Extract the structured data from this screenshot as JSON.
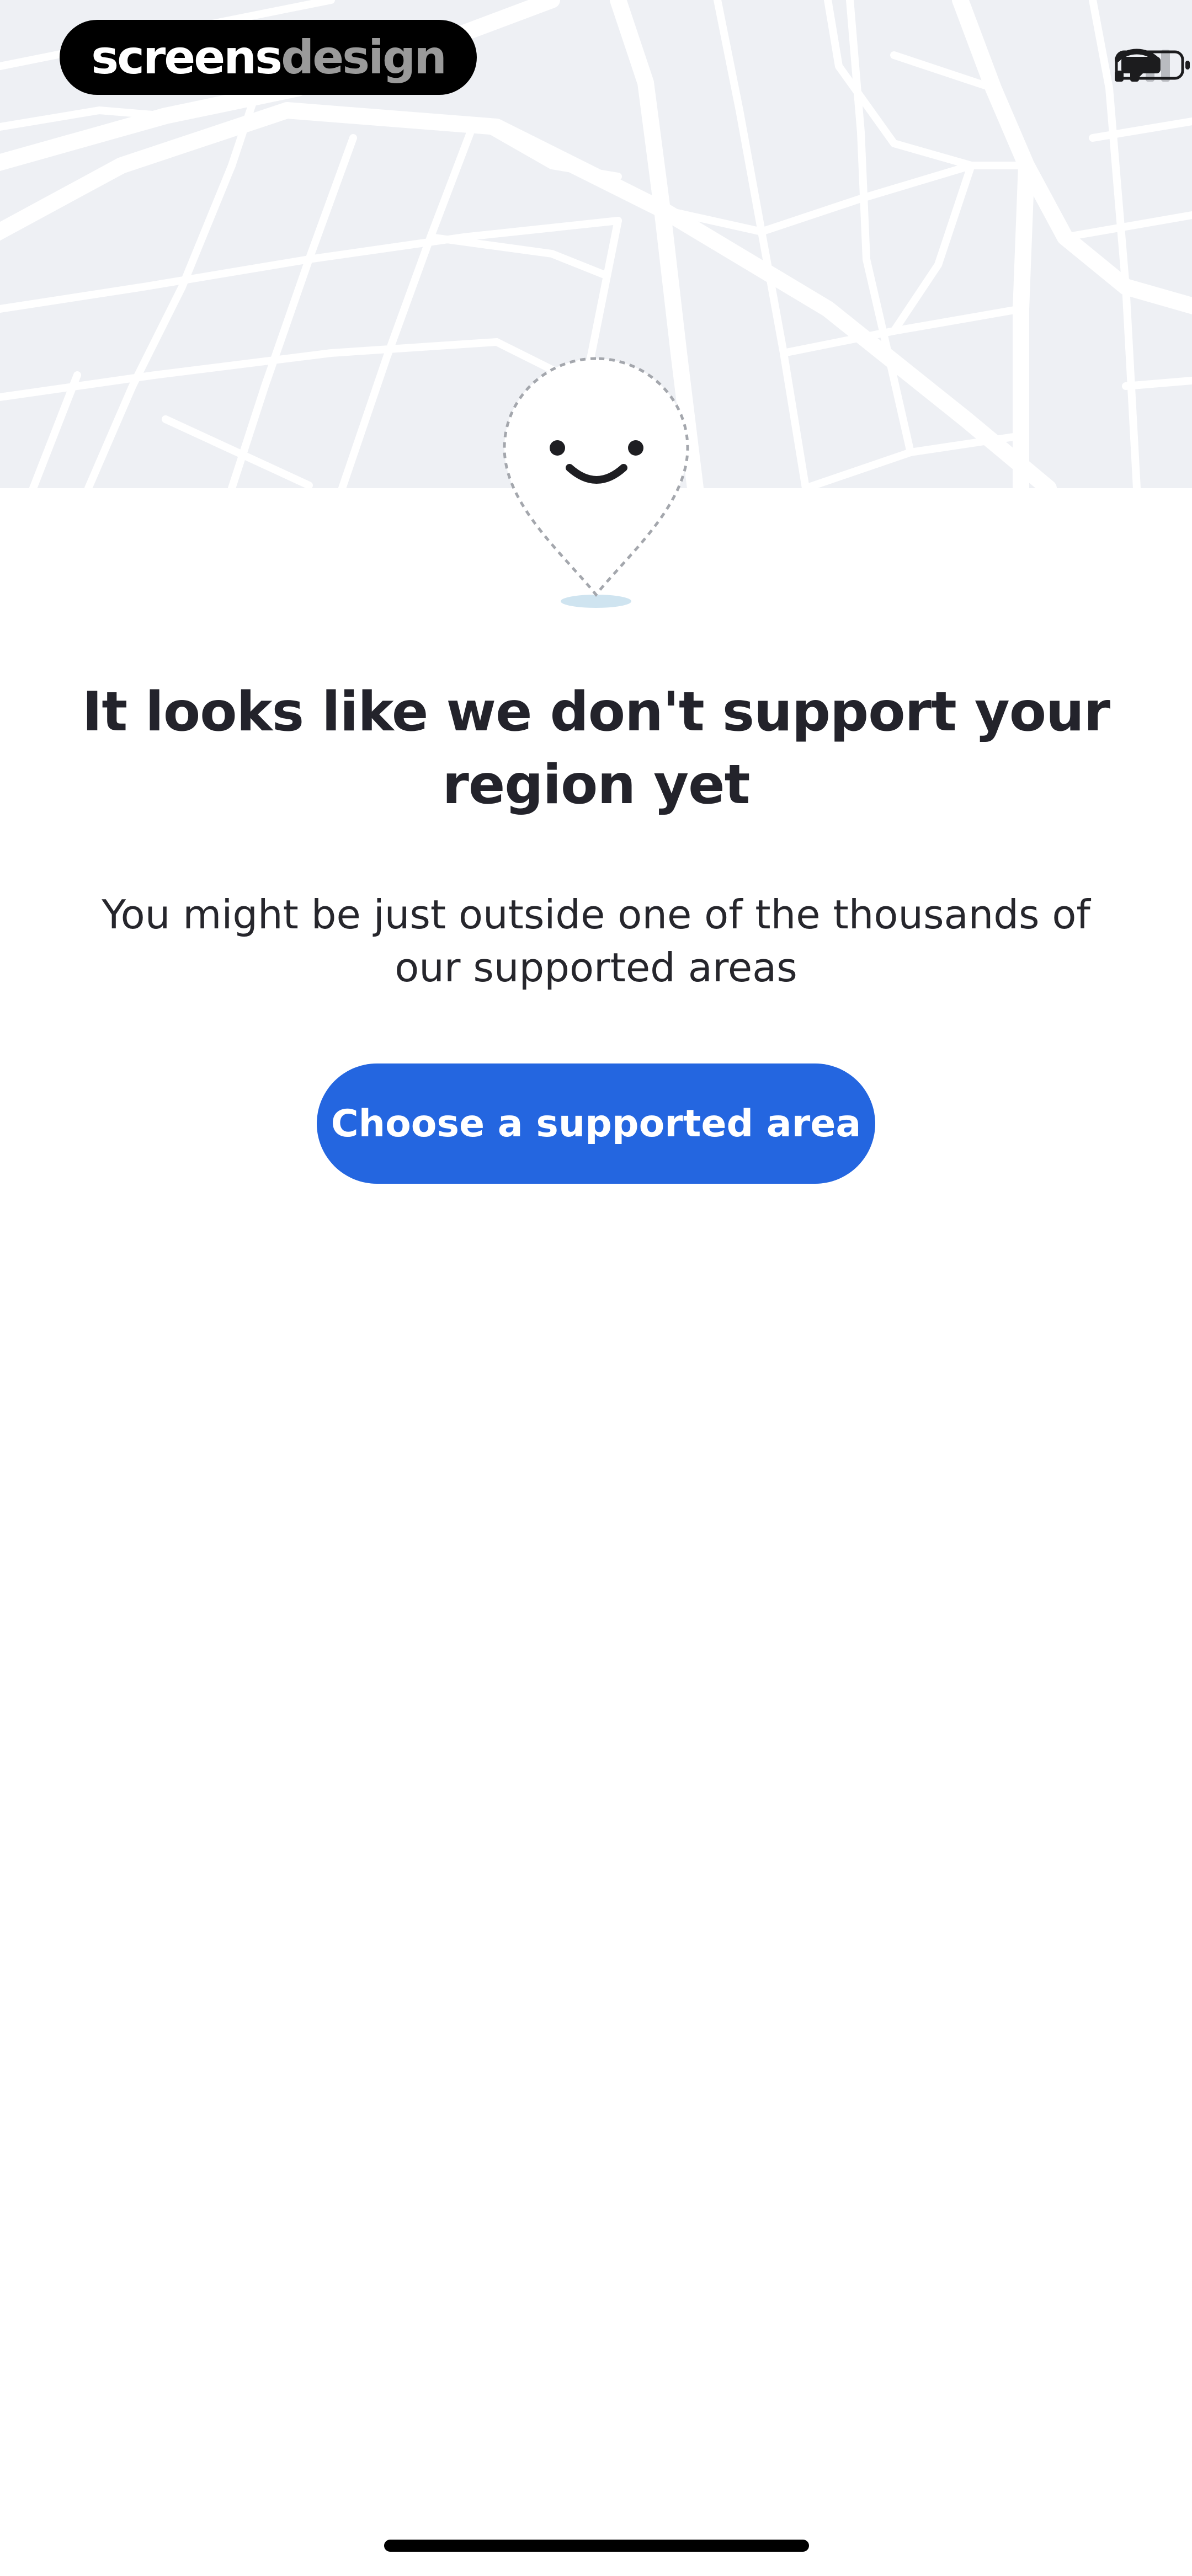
{
  "watermark": {
    "part1": "screens",
    "part2": "design"
  },
  "status_bar": {
    "signal_icon": "cellular-signal-icon",
    "wifi_icon": "wifi-icon",
    "battery_icon": "battery-icon",
    "battery_level": 0.7
  },
  "illustration": {
    "icon": "smiling-map-pin-icon"
  },
  "message": {
    "title": "It looks like we don't support your region yet",
    "body": "You might be just outside one of the thousands of our supported areas"
  },
  "actions": {
    "primary_label": "Choose a supported area"
  },
  "colors": {
    "accent": "#2466e0",
    "map_background": "#eef0f4",
    "text": "#23232b"
  }
}
